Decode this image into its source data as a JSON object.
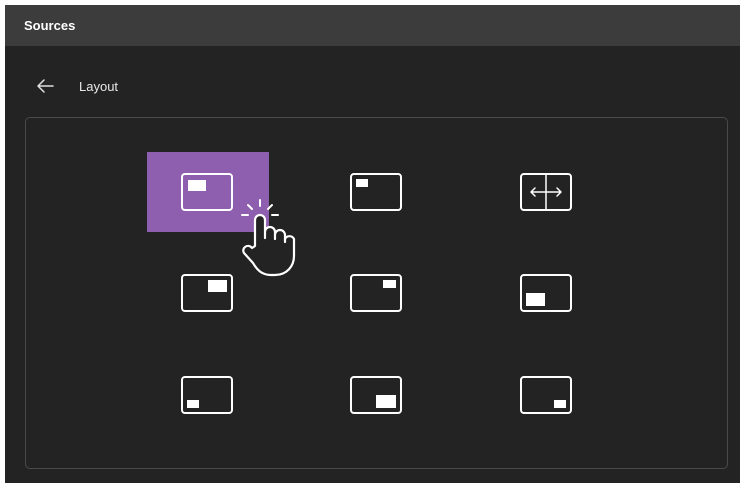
{
  "window": {
    "title": "Sources"
  },
  "header": {
    "back_icon": "arrow-left-icon",
    "label": "Layout"
  },
  "layout_options": [
    {
      "icon": "layout-top-left-icon",
      "selected": true
    },
    {
      "icon": "layout-top-left-small-icon",
      "selected": false
    },
    {
      "icon": "layout-side-by-side-icon",
      "selected": false
    },
    {
      "icon": "layout-top-right-icon",
      "selected": false
    },
    {
      "icon": "layout-top-right-small-icon",
      "selected": false
    },
    {
      "icon": "layout-bottom-left-large-icon",
      "selected": false
    },
    {
      "icon": "layout-bottom-left-small-icon",
      "selected": false
    },
    {
      "icon": "layout-bottom-right-icon",
      "selected": false
    },
    {
      "icon": "layout-bottom-right-small-icon",
      "selected": false
    }
  ],
  "colors": {
    "selected_tile": "#8e5fae",
    "background": "#232323",
    "titlebar": "#3c3c3c"
  }
}
